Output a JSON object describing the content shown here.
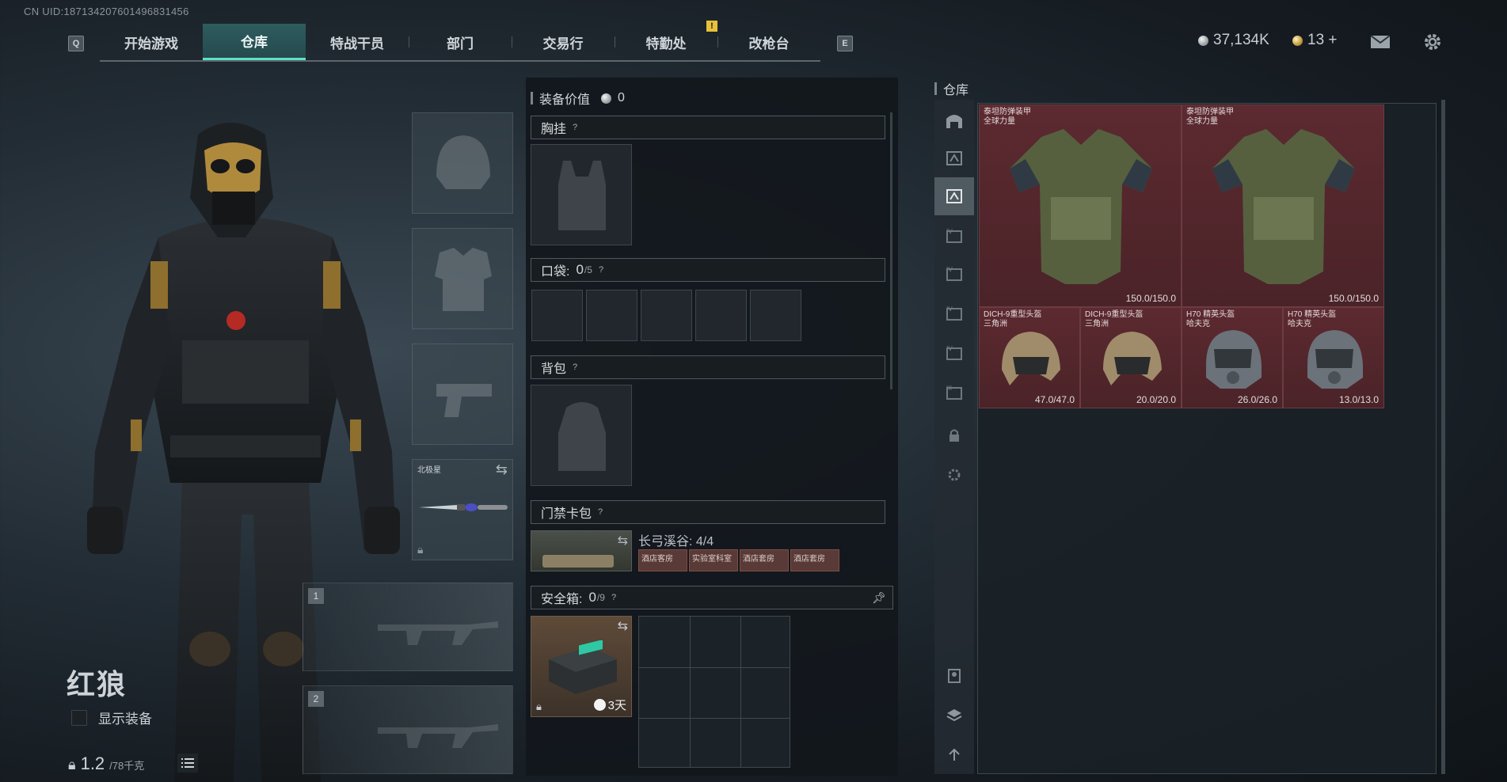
{
  "uid_text": "CN UID:187134207601496831456",
  "tabs": [
    {
      "label": "开始游戏"
    },
    {
      "label": "仓库"
    },
    {
      "label": "特战干员"
    },
    {
      "label": "部门"
    },
    {
      "label": "交易行"
    },
    {
      "label": "特勤处"
    },
    {
      "label": "改枪台"
    }
  ],
  "key_prev": "Q",
  "key_next": "E",
  "notif_mark": "!",
  "currency": {
    "silver": "37,134K",
    "gold": "13 +"
  },
  "operator": {
    "name": "红狼",
    "show_equipment": "显示装备"
  },
  "weight": {
    "current": "1.2",
    "max": "/78千克"
  },
  "melee": {
    "label": "北极星"
  },
  "weapon_slots": [
    {
      "num": "1"
    },
    {
      "num": "2"
    }
  ],
  "loadout": {
    "value_label": "装备价值",
    "value": "0",
    "chest_rig": {
      "label": "胸挂",
      "help": "?"
    },
    "pockets": {
      "label": "口袋:",
      "count": "0",
      "capacity": "/5",
      "help": "?"
    },
    "backpack": {
      "label": "背包",
      "help": "?"
    },
    "keycard": {
      "label": "门禁卡包",
      "help": "?",
      "name": "长弓溪谷: 4/4",
      "cards": [
        "酒店客房",
        "实验室科室",
        "酒店套房",
        "酒店套房"
      ]
    },
    "safe_box": {
      "label": "安全箱:",
      "count": "0",
      "capacity": "/9",
      "help": "?",
      "timer": "3天"
    }
  },
  "warehouse": {
    "title": "仓库",
    "items": [
      {
        "name1": "泰坦防弹装甲",
        "name2": "全球力量",
        "durability": "150.0/150.0",
        "kind": "armor"
      },
      {
        "name1": "泰坦防弹装甲",
        "name2": "全球力量",
        "durability": "150.0/150.0",
        "kind": "armor"
      },
      {
        "name1": "DICH-9重型头盔",
        "name2": "三角洲",
        "durability": "47.0/47.0",
        "kind": "helmet-tan"
      },
      {
        "name1": "DICH-9重型头盔",
        "name2": "三角洲",
        "durability": "20.0/20.0",
        "kind": "helmet-tan"
      },
      {
        "name1": "H70 精英头盔",
        "name2": "哈夫克",
        "durability": "26.0/26.0",
        "kind": "helmet-gray"
      },
      {
        "name1": "H70 精英头盔",
        "name2": "哈夫克",
        "durability": "13.0/13.0",
        "kind": "helmet-gray"
      }
    ]
  },
  "colors": {
    "accent": "#5fe0c8",
    "item_bg": "#5c2a30",
    "panel": "#12171c"
  },
  "icons": {
    "mail": "mail-icon",
    "settings": "gear-icon",
    "swap": "swap-icon",
    "lock": "lock-icon",
    "pin": "pin-icon",
    "list": "list-icon"
  }
}
